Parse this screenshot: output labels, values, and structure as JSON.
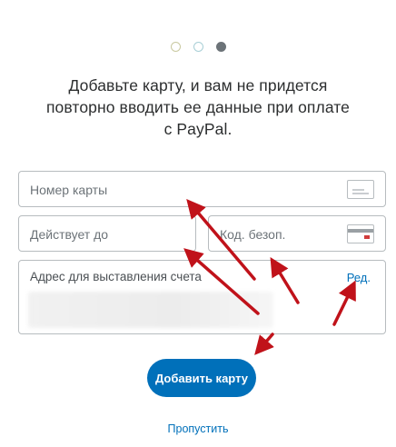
{
  "progress": {
    "current_step": 3,
    "total_steps": 3
  },
  "intro": {
    "line1": "Добавьте карту, и вам не придется",
    "line2": "повторно вводить ее данные при оплате",
    "line3": "с PayPal."
  },
  "form": {
    "card_number_placeholder": "Номер карты",
    "expiry_placeholder": "Действует до",
    "security_code_placeholder": "Код. безоп.",
    "billing_address_label": "Адрес для выставления счета",
    "edit_link": "Ред."
  },
  "buttons": {
    "add_card": "Добавить карту",
    "skip": "Пропустить"
  },
  "colors": {
    "accent": "#0070ba",
    "annotation_arrows": "#c0121a"
  },
  "icons": [
    "card-icon",
    "security-code-card-icon"
  ]
}
